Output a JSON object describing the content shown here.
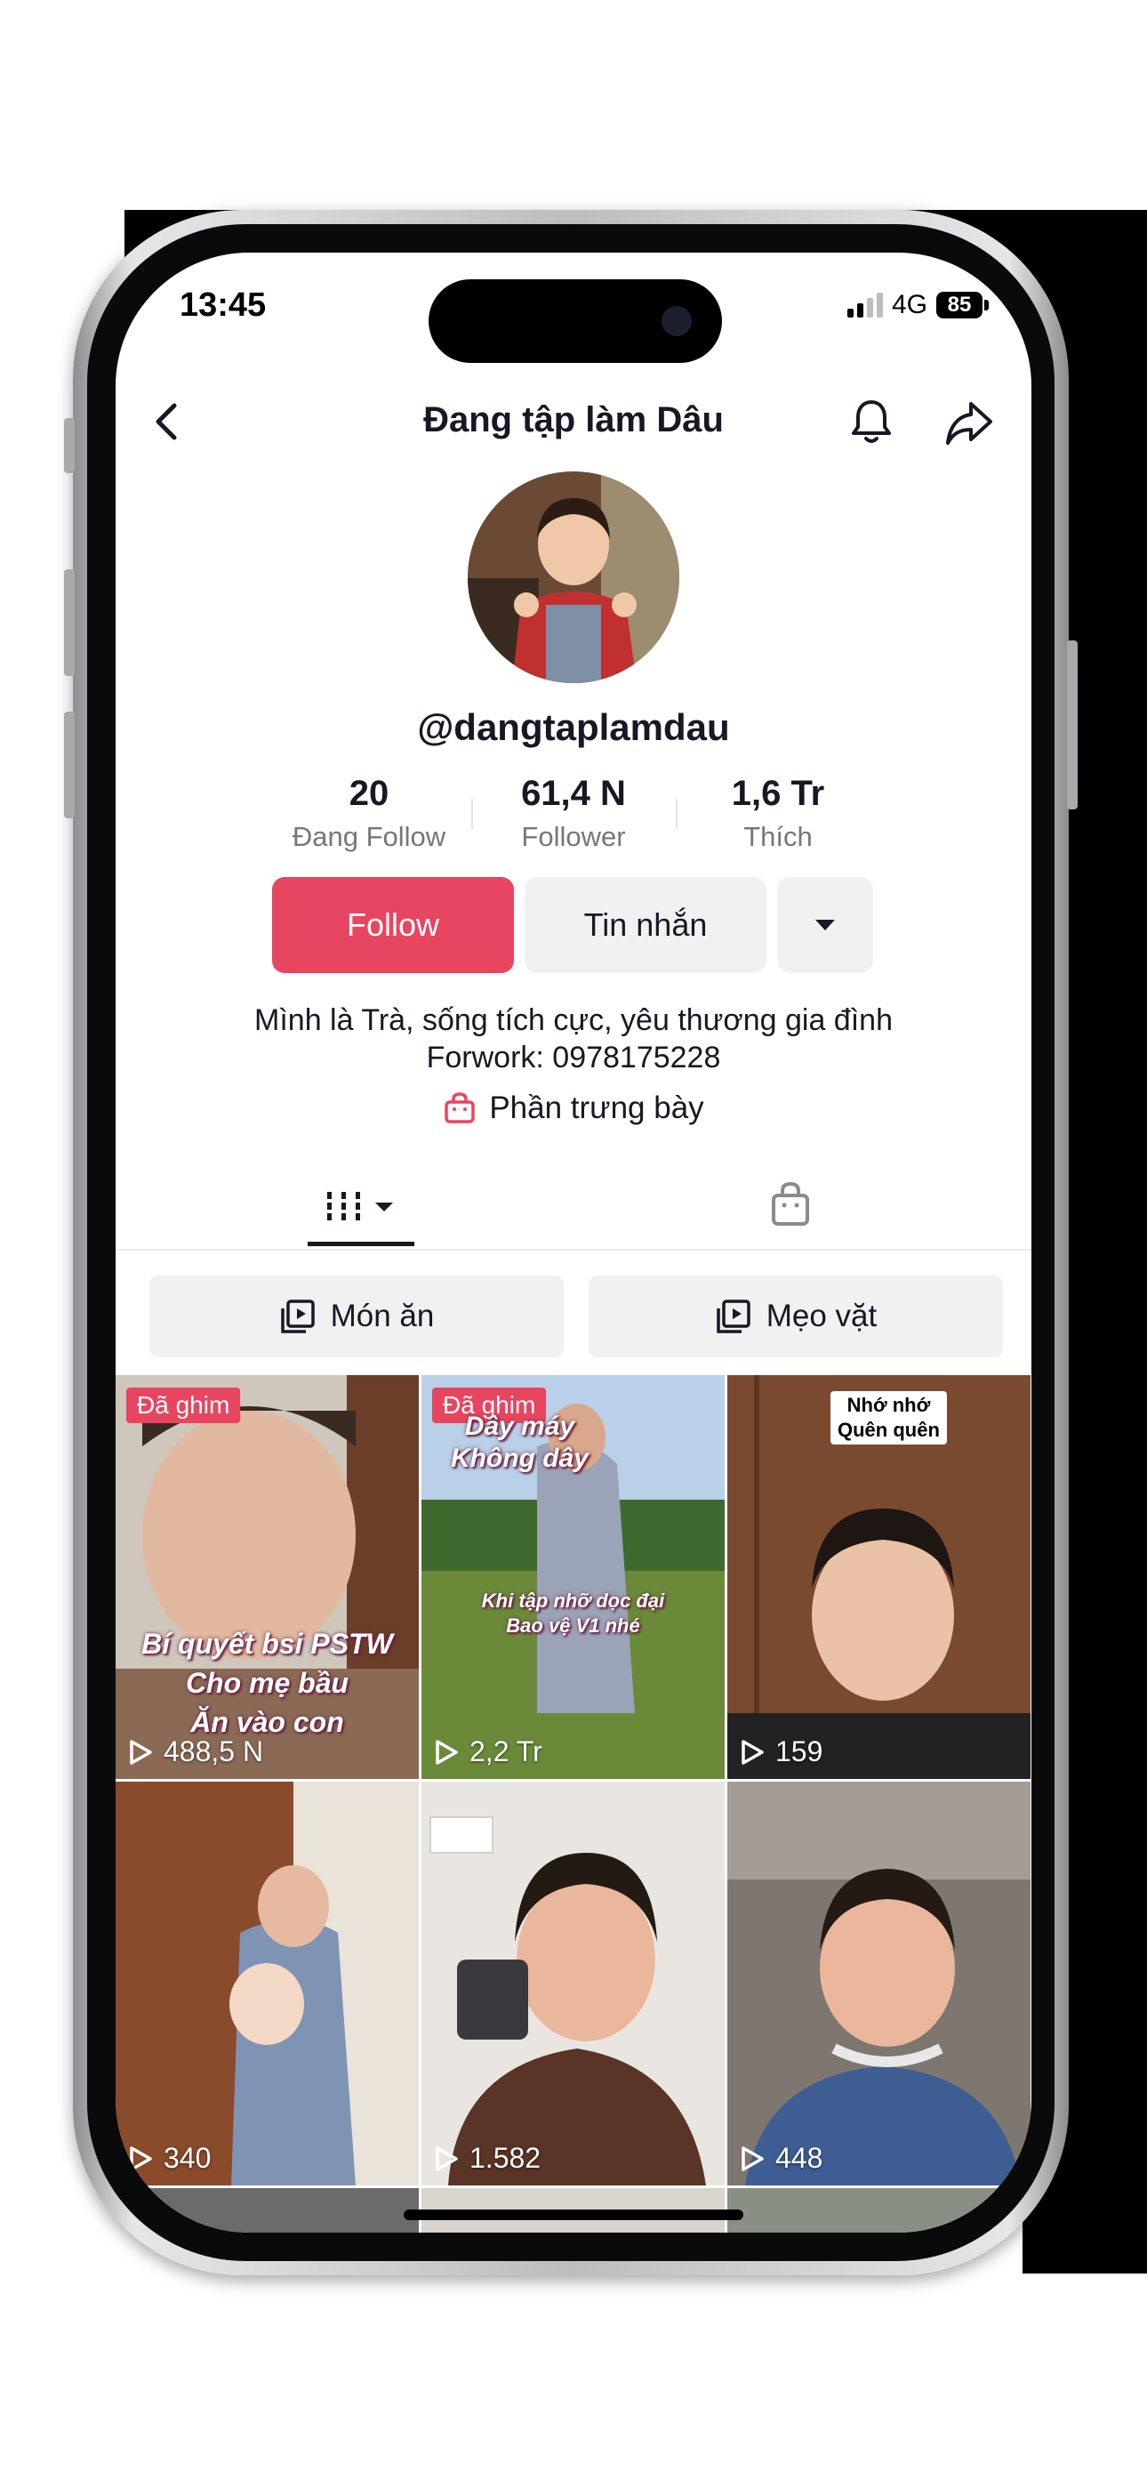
{
  "status_bar": {
    "time": "13:45",
    "network": "4G",
    "battery": "85"
  },
  "nav": {
    "title": "Đang tập làm Dâu"
  },
  "profile": {
    "username": "@dangtaplamdau",
    "stats": [
      {
        "value": "20",
        "label": "Đang Follow"
      },
      {
        "value": "61,4 N",
        "label": "Follower"
      },
      {
        "value": "1,6 Tr",
        "label": "Thích"
      }
    ],
    "buttons": {
      "follow": "Follow",
      "message": "Tin nhắn"
    },
    "bio_line1": "Mình là Trà, sống tích cực, yêu thương gia đình",
    "bio_line2": "Forwork: 0978175228",
    "showcase": "Phần trưng bày"
  },
  "playlists": [
    {
      "label": "Món ăn"
    },
    {
      "label": "Mẹo vặt"
    }
  ],
  "videos": [
    {
      "pinned": "Đã ghim",
      "views": "488,5 N",
      "caption_lines": [
        "Bí quyết bsi PSTW",
        "Cho mẹ bầu",
        "Ăn vào con"
      ]
    },
    {
      "pinned": "Đã ghim",
      "views": "2,2 Tr",
      "top_caption": [
        "Dây máy",
        "Không dây"
      ],
      "mid_caption": [
        "Khi tập nhỡ dọc đại",
        "Bao vệ V1 nhé"
      ]
    },
    {
      "views": "159",
      "label_lines": [
        "Nhớ nhớ",
        "Quên quên"
      ]
    },
    {
      "views": "340"
    },
    {
      "views": "1.582"
    },
    {
      "views": "448"
    }
  ],
  "colors": {
    "accent": "#e84560",
    "text": "#161823",
    "secondary": "#75777f",
    "button_bg": "#f1f1f2"
  }
}
